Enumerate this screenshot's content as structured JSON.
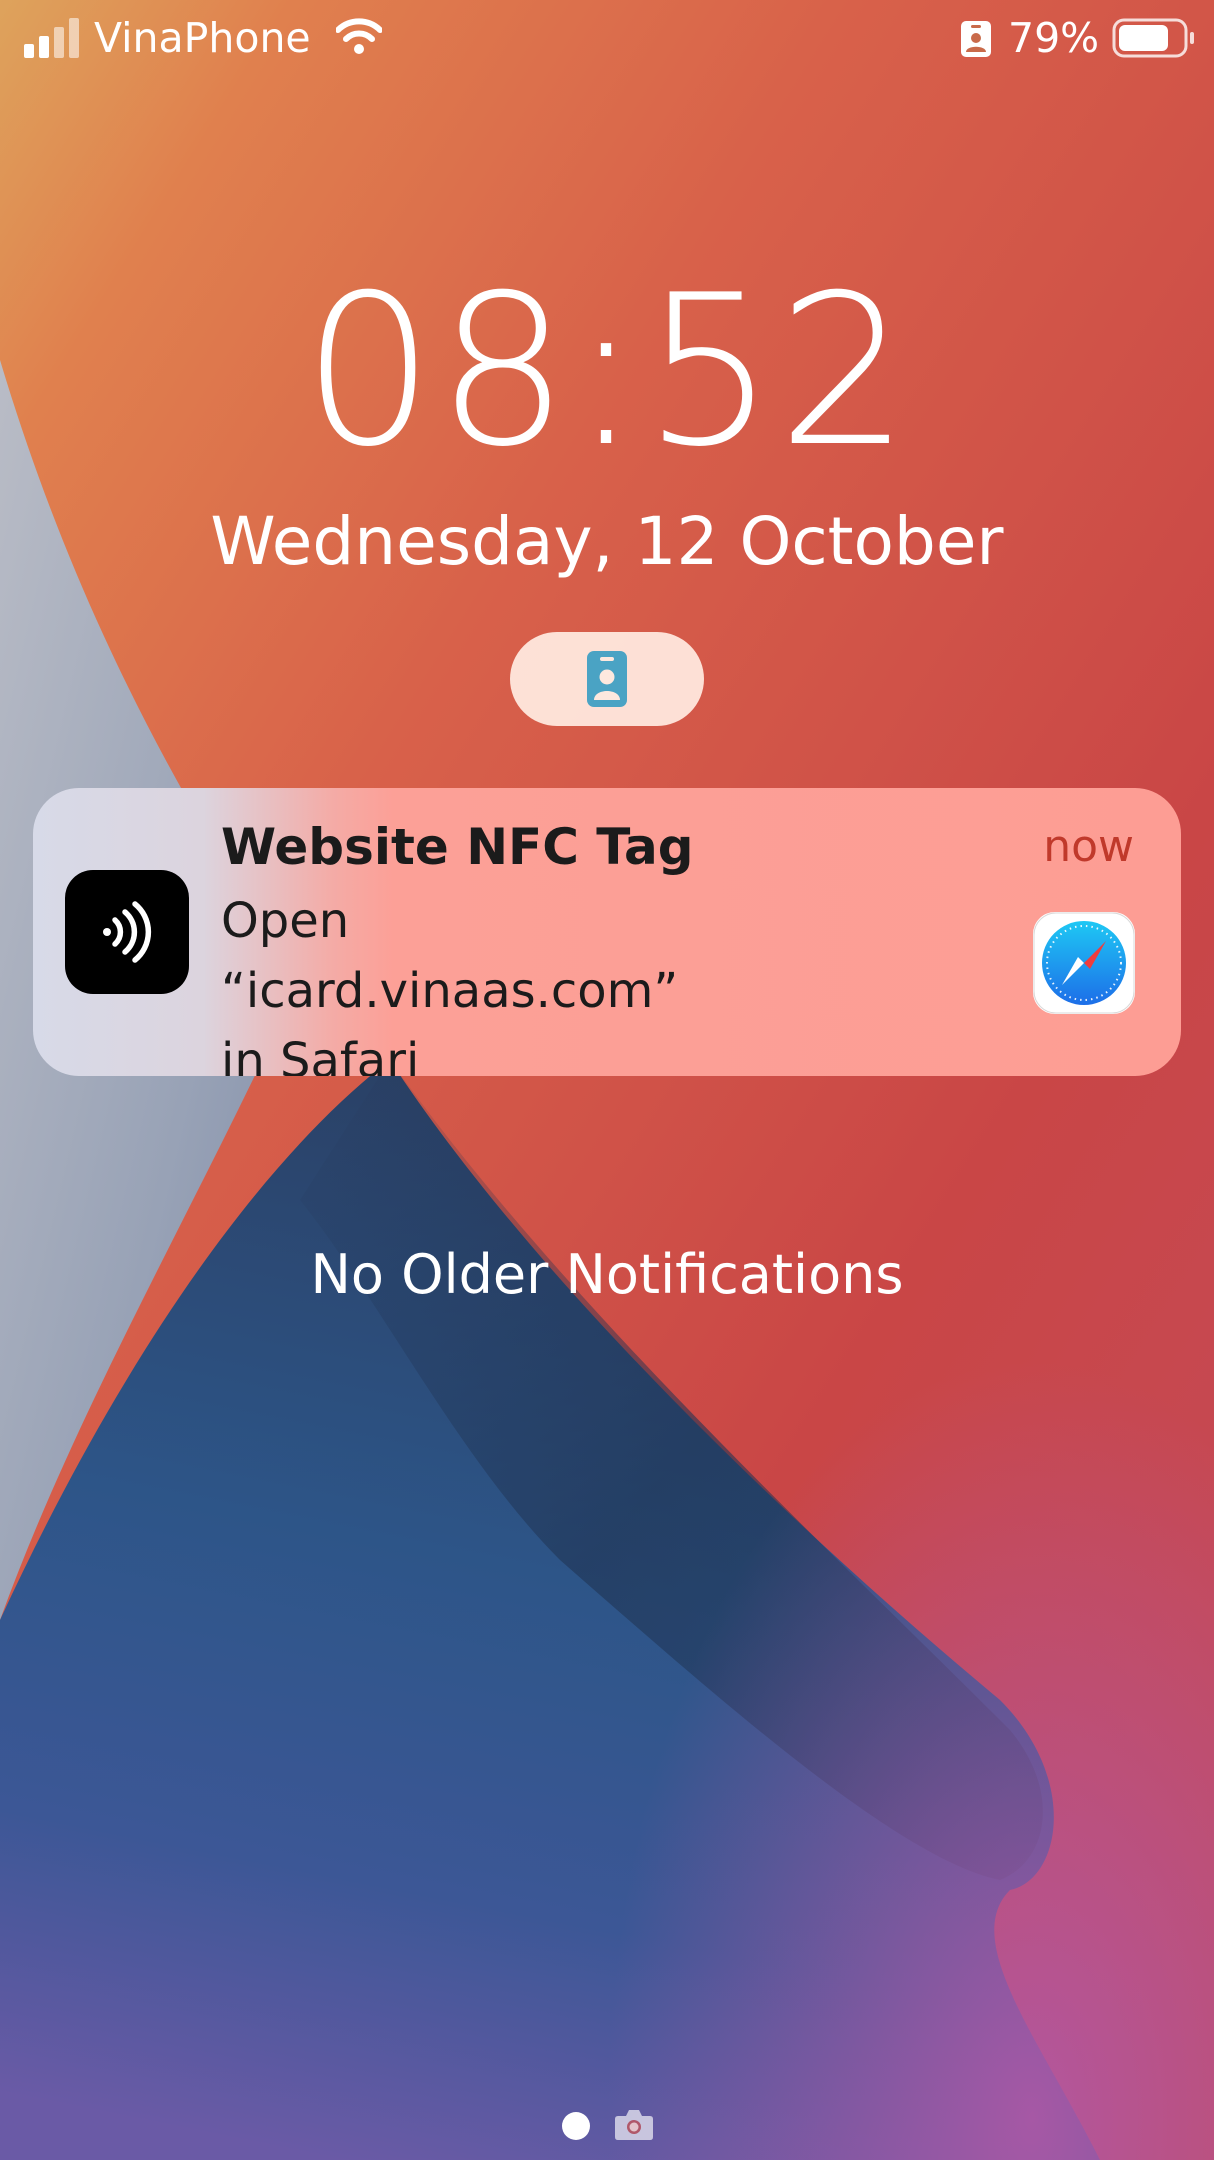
{
  "status_bar": {
    "carrier": "VinaPhone",
    "battery_percent": "79%",
    "battery_level": 0.79,
    "icons": [
      "signal-icon",
      "wifi-icon",
      "id-badge-icon",
      "battery-icon"
    ]
  },
  "lock_screen": {
    "time": "08:52",
    "date": "Wednesday, 12 October",
    "pill_icon": "id-badge-icon"
  },
  "notification": {
    "app_icon": "nfc-icon",
    "title": "Website NFC Tag",
    "body": "Open “icard.vinaas.com”\nin Safari",
    "time": "now",
    "attachment_icon": "safari-icon"
  },
  "no_older_text": "No Older Notifications",
  "bottom": {
    "icons": [
      "page-dot",
      "camera-icon"
    ]
  },
  "colors": {
    "wallpaper_orange": "#e0694a",
    "wallpaper_red": "#c94a45",
    "wallpaper_blue": "#2c4f7c",
    "wallpaper_gray": "#a9b1c2",
    "notification_time": "#c0392b"
  }
}
